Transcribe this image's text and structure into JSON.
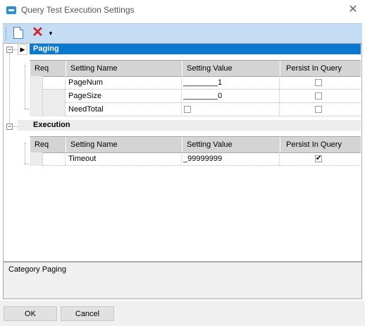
{
  "window": {
    "title": "Query Test Execution Settings",
    "close_glyph": "✕",
    "accent": "#2b8fd6"
  },
  "toolbar": {
    "new_icon": "new-document-icon",
    "delete_glyph": "✕",
    "dropdown_glyph": "▼"
  },
  "categories": [
    {
      "name": "Paging",
      "selected": true,
      "columns": [
        "Req",
        "Setting Name",
        "Setting Value",
        "Persist In Query"
      ],
      "rows": [
        {
          "name": "PageNum",
          "value": "________1",
          "value_type": "text",
          "persist": false
        },
        {
          "name": "PageSize",
          "value": "________0",
          "value_type": "text",
          "persist": false
        },
        {
          "name": "NeedTotal",
          "value": "",
          "value_type": "checkbox",
          "value_checked": false,
          "persist": false
        }
      ]
    },
    {
      "name": "Execution",
      "selected": false,
      "columns": [
        "Req",
        "Setting Name",
        "Setting Value",
        "Persist In Query"
      ],
      "rows": [
        {
          "name": "Timeout",
          "value": "_99999999",
          "value_type": "text",
          "persist": true
        }
      ]
    }
  ],
  "status": {
    "text": "Category Paging"
  },
  "buttons": {
    "ok": "OK",
    "cancel": "Cancel"
  },
  "colors": {
    "selected_row": "#0b79d0",
    "toolbar": "#c5dcf5",
    "header": "#d4d4d4"
  },
  "glyphs": {
    "expand": "▶",
    "collapse": "−",
    "check": "✔"
  }
}
